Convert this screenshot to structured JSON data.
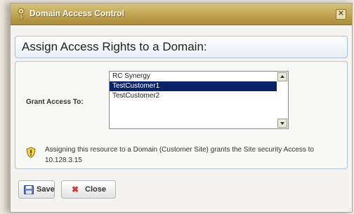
{
  "dialog": {
    "title": "Domain Access Control",
    "close_glyph": "✕",
    "heading": "Assign Access Rights to a Domain:"
  },
  "form": {
    "grant_label": "Grant Access To:",
    "options": [
      "RC Synergy",
      "TestCustomer1",
      "TestCustomer2"
    ],
    "selected": "TestCustomer1"
  },
  "info": {
    "icon": "shield-info-icon",
    "text": "Assigning this resource to a Domain (Customer Site) grants the Site security Access to 10.128.3.15"
  },
  "buttons": {
    "save_label": "Save",
    "close_label": "Close",
    "close_glyph": "✖"
  },
  "colors": {
    "titlebar": "#c0a452",
    "selection": "#0a246a",
    "close_icon": "#d8322f"
  }
}
